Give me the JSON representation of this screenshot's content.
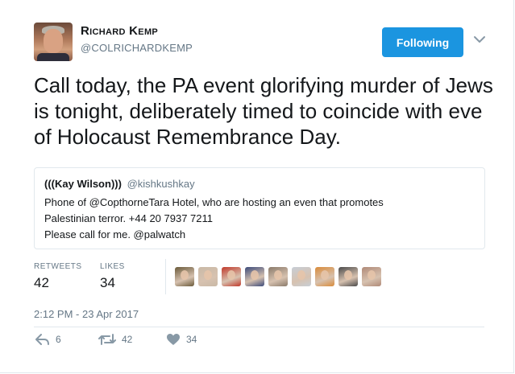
{
  "author": {
    "name": "Richard Kemp",
    "handle": "@COLRICHARDKEMP"
  },
  "follow_button": {
    "label": "Following"
  },
  "tweet": {
    "text": "Call today, the PA event glorifying murder of Jews is tonight, deliberately timed to coincide with eve of Holocaust Remembrance Day."
  },
  "quoted": {
    "name": "(((Kay Wilson)))",
    "handle": "@kishkushkay",
    "lines": [
      "Phone of @CopthorneTara Hotel, who are hosting an even that promotes",
      "Palestinian terror. +44 20 7937 7211",
      "Please call for me. @palwatch"
    ]
  },
  "stats": {
    "retweets_label": "RETWEETS",
    "retweets_value": "42",
    "likes_label": "LIKES",
    "likes_value": "34"
  },
  "likers": [
    {
      "name": "liker-1",
      "color": "#6a5a3a"
    },
    {
      "name": "liker-2",
      "color": "#c9b9a6"
    },
    {
      "name": "liker-3",
      "color": "#c0392b"
    },
    {
      "name": "liker-4",
      "color": "#3b4a7a"
    },
    {
      "name": "liker-5",
      "color": "#8a7a6a"
    },
    {
      "name": "liker-6",
      "color": "#c7ced6"
    },
    {
      "name": "liker-7",
      "color": "#d98b3a"
    },
    {
      "name": "liker-8",
      "color": "#4a4a4a"
    },
    {
      "name": "liker-9",
      "color": "#b08a78"
    }
  ],
  "timestamp": "2:12 PM - 23 Apr 2017",
  "actions": {
    "reply_count": "6",
    "retweet_count": "42",
    "like_count": "34"
  },
  "colors": {
    "accent": "#1b95e0",
    "secondary_text": "#657786",
    "border": "#e1e8ed"
  },
  "icons": [
    "chevron-down-icon",
    "reply-icon",
    "retweet-icon",
    "heart-icon"
  ]
}
